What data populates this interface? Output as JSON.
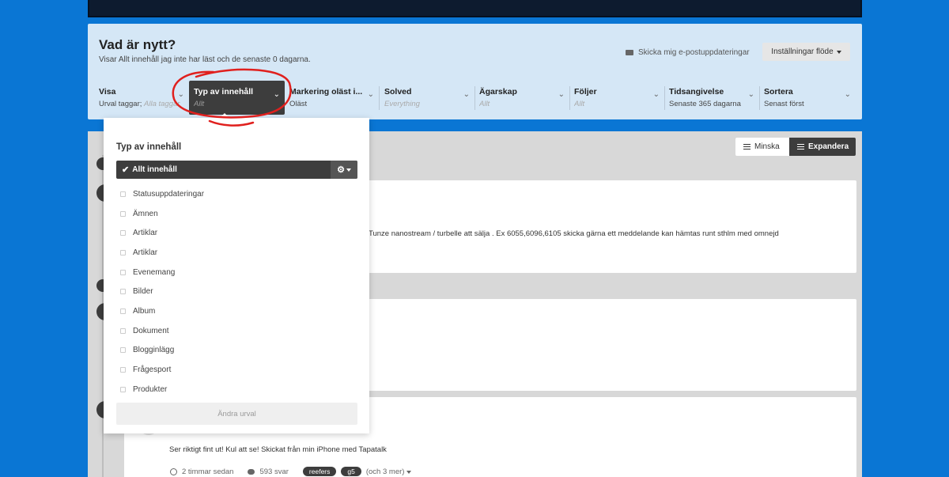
{
  "header": {
    "title": "Vad är nytt?",
    "subtitle": "Visar Allt innehåll jag inte har läst och de senaste 0 dagarna.",
    "email_link": "Skicka mig e-postuppdateringar",
    "settings_button": "Inställningar flöde"
  },
  "filters": [
    {
      "label": "Visa",
      "value": "Urval taggar;",
      "muted": "Alla taggar"
    },
    {
      "label": "Typ av innehåll",
      "value": "",
      "muted": "Allt"
    },
    {
      "label": "Markering oläst i...",
      "value": "Oläst",
      "muted": ""
    },
    {
      "label": "Solved",
      "value": "",
      "muted": "Everything"
    },
    {
      "label": "Ägarskap",
      "value": "",
      "muted": "Allt"
    },
    {
      "label": "Följer",
      "value": "",
      "muted": "Allt"
    },
    {
      "label": "Tidsangivelse",
      "value": "Senaste 365 dagarna",
      "muted": ""
    },
    {
      "label": "Sortera",
      "value": "Senast först",
      "muted": ""
    }
  ],
  "view_toggle": {
    "collapse": "Minska",
    "expand": "Expandera"
  },
  "feed": {
    "excerpt1": "Tunze nanostream / turbelle att sälja . Ex 6055,6096,6105 skicka gärna ett meddelande kan hämtas runt sthlm med omnejd",
    "excerpt2": "Ser riktigt fint ut! Kul att se! Skickat från min iPhone med Tapatalk",
    "time": "2 timmar sedan",
    "replies": "593 svar",
    "tags": [
      "reefers",
      "g5"
    ],
    "more_tags": "(och 3 mer)"
  },
  "dropdown": {
    "title": "Typ av innehåll",
    "selected": "Allt innehåll",
    "items": [
      "Statusuppdateringar",
      "Ämnen",
      "Artiklar",
      "Artiklar",
      "Evenemang",
      "Bilder",
      "Album",
      "Dokument",
      "Blogginlägg",
      "Frågesport",
      "Produkter"
    ],
    "apply_button": "Ändra urval"
  },
  "colors": {
    "page_bg": "#0a76d4",
    "header_bg": "#d5e7f6",
    "dark": "#3d3d3d",
    "annotation": "#e0201e"
  }
}
